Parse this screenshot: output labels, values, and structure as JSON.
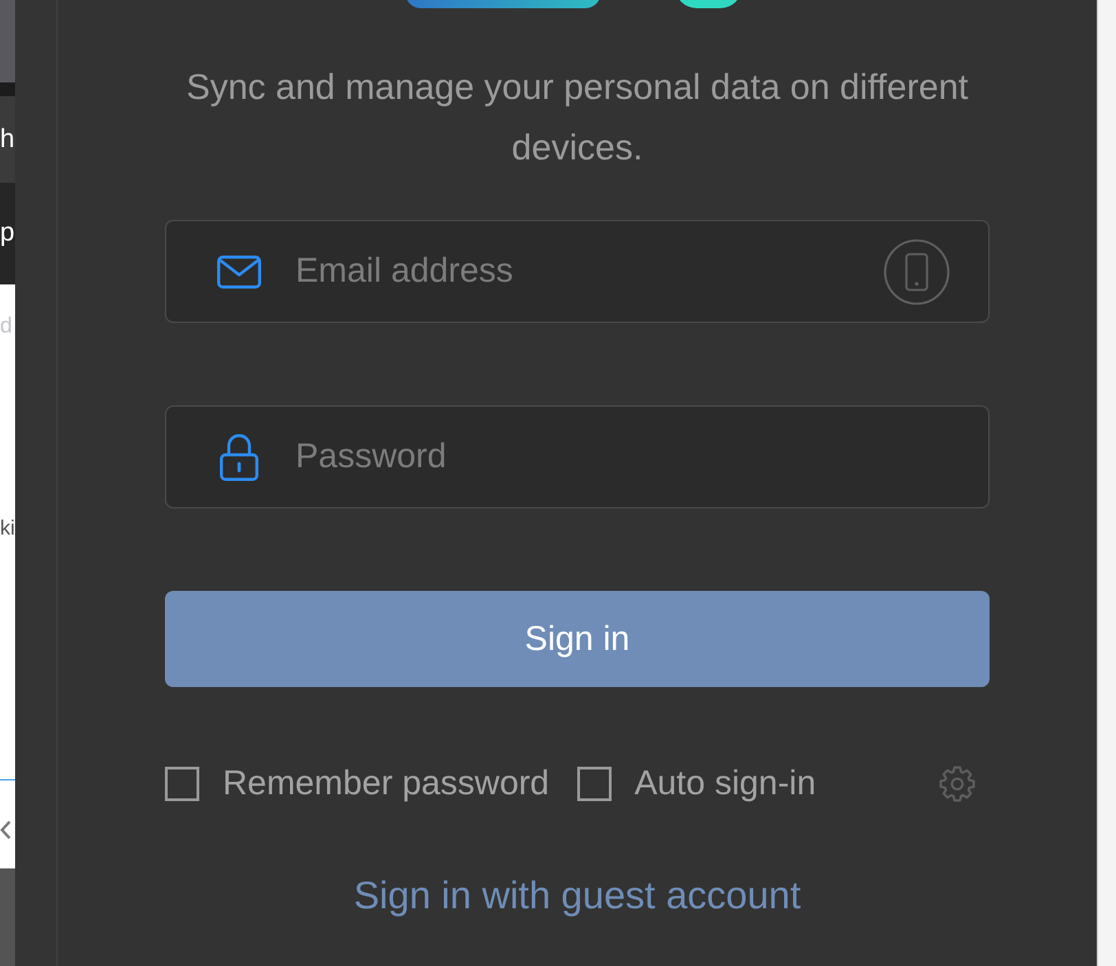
{
  "background_window": {
    "texts": [
      "h",
      "p",
      "d",
      "ki"
    ]
  },
  "header": {
    "description": "Sync and manage your personal data on different devices."
  },
  "form": {
    "fields": [
      {
        "kind": "email",
        "placeholder": "Email address"
      },
      {
        "kind": "password",
        "placeholder": "Password"
      }
    ],
    "submit_button": {
      "label": "Sign in"
    },
    "options": [
      {
        "label": "Remember password",
        "checked": false
      },
      {
        "label": "Auto sign-in",
        "checked": false
      }
    ],
    "guest_link": {
      "label": "Sign in with guest account"
    }
  }
}
